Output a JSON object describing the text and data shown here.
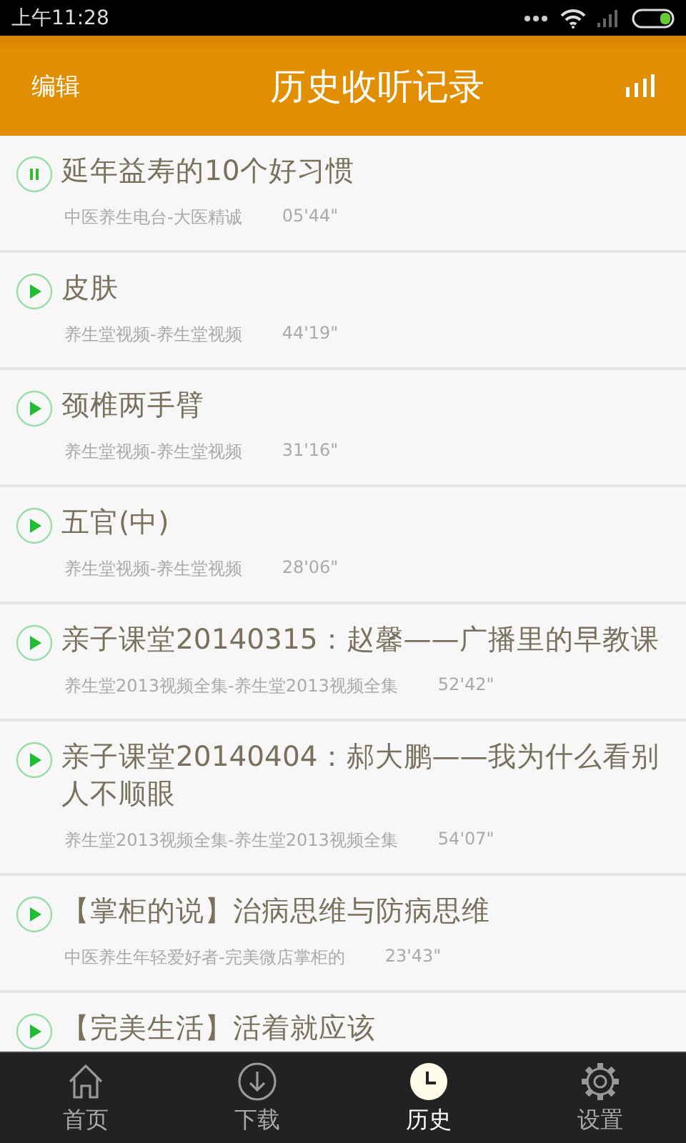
{
  "status_bar": {
    "time": "上午11:28"
  },
  "header": {
    "edit": "编辑",
    "title": "历史收听记录"
  },
  "items": [
    {
      "title": "延年益寿的10个好习惯",
      "source": "中医养生电台-大医精诚",
      "duration": "05'44\"",
      "playing": true
    },
    {
      "title": "皮肤",
      "source": "养生堂视频-养生堂视频",
      "duration": "44'19\"",
      "playing": false
    },
    {
      "title": "颈椎两手臂",
      "source": "养生堂视频-养生堂视频",
      "duration": "31'16\"",
      "playing": false
    },
    {
      "title": "五官(中)",
      "source": "养生堂视频-养生堂视频",
      "duration": "28'06\"",
      "playing": false
    },
    {
      "title": "亲子课堂20140315：赵馨——广播里的早教课",
      "source": "养生堂2013视频全集-养生堂2013视频全集",
      "duration": "52'42\"",
      "playing": false
    },
    {
      "title": "亲子课堂20140404：郝大鹏——我为什么看别人不顺眼",
      "source": "养生堂2013视频全集-养生堂2013视频全集",
      "duration": "54'07\"",
      "playing": false
    },
    {
      "title": "【掌柜的说】治病思维与防病思维",
      "source": "中医养生年轻爱好者-完美微店掌柜的",
      "duration": "23'43\"",
      "playing": false
    },
    {
      "title": "【完美生活】活着就应该",
      "playing": false
    }
  ],
  "tabs": [
    {
      "kind": "home",
      "label": "首页",
      "selected": false
    },
    {
      "kind": "download",
      "label": "下载",
      "selected": false
    },
    {
      "kind": "history",
      "label": "历史",
      "selected": true
    },
    {
      "kind": "settings",
      "label": "设置",
      "selected": false
    }
  ]
}
